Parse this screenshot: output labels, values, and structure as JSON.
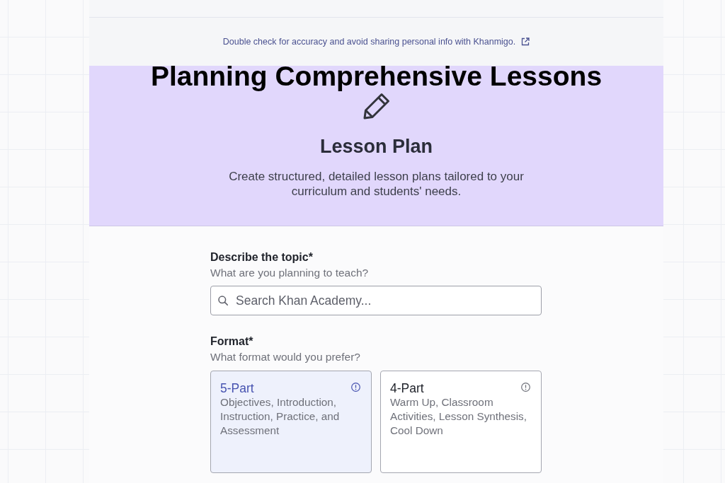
{
  "disclaimer": {
    "text": "Double check for accuracy and avoid sharing personal info with Khanmigo."
  },
  "overlay_title": "Planning Comprehensive Lessons",
  "header": {
    "title": "Lesson Plan",
    "description": "Create structured, detailed lesson plans tailored to your curriculum and students' needs."
  },
  "fields": [
    {
      "kind": "search",
      "label": "Describe the topic*",
      "hint": "What are you planning to teach?",
      "placeholder": "Search Khan Academy..."
    },
    {
      "kind": "choice",
      "label": "Format*",
      "hint": "What format would you prefer?",
      "options": [
        {
          "title": "5-Part",
          "description": "Objectives, Introduction, Instruction, Practice, and Assessment",
          "selected": true
        },
        {
          "title": "4-Part",
          "description": "Warm Up, Classroom Activities, Lesson Synthesis, Cool Down",
          "selected": false
        }
      ]
    }
  ]
}
